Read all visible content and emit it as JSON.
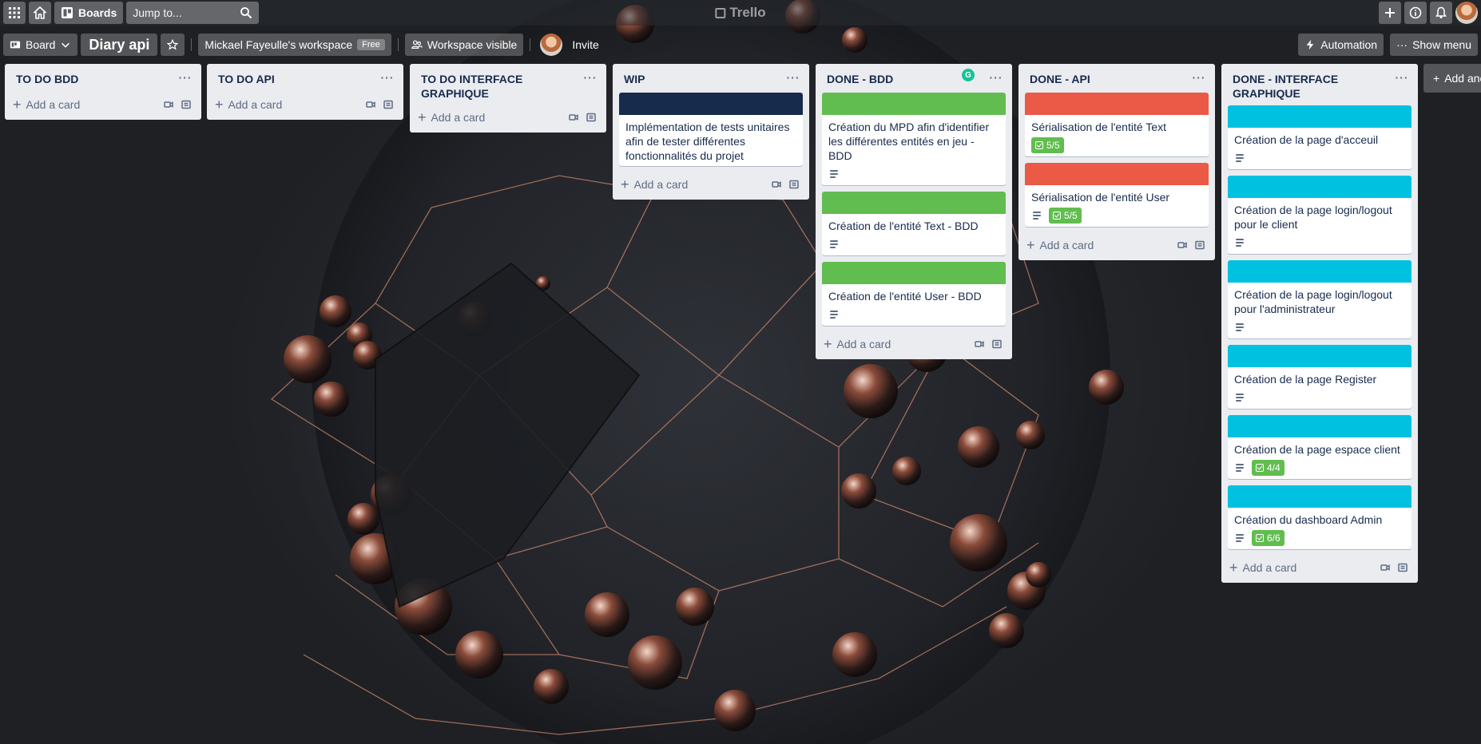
{
  "header": {
    "boards_label": "Boards",
    "search_placeholder": "Jump to...",
    "logo_text": "Trello"
  },
  "board_header": {
    "view_label": "Board",
    "title": "Diary api",
    "workspace_name": "Mickael Fayeulle's workspace",
    "workspace_badge": "Free",
    "visibility_label": "Workspace visible",
    "invite_label": "Invite",
    "automation_label": "Automation",
    "show_menu_label": "Show menu"
  },
  "lists": [
    {
      "title": "TO DO BDD",
      "add_label": "Add a card",
      "cards": []
    },
    {
      "title": "TO DO API",
      "add_label": "Add a card",
      "cards": []
    },
    {
      "title": "TO DO INTERFACE GRAPHIQUE",
      "add_label": "Add a card",
      "cards": []
    },
    {
      "title": "WIP",
      "add_label": "Add a card",
      "cards": [
        {
          "cover": "#172b4d",
          "title": "Implémentation de tests unitaires afin de tester différentes fonctionnalités du projet",
          "desc": false,
          "checklist": ""
        }
      ]
    },
    {
      "title": "DONE - BDD",
      "add_label": "Add a card",
      "cards": [
        {
          "cover": "#61bd4f",
          "title": "Création du MPD afin d'identifier les différentes entités en jeu - BDD",
          "desc": true,
          "checklist": ""
        },
        {
          "cover": "#61bd4f",
          "title": "Création de l'entité Text - BDD",
          "desc": true,
          "checklist": ""
        },
        {
          "cover": "#61bd4f",
          "title": "Création de l'entité User - BDD",
          "desc": true,
          "checklist": ""
        }
      ]
    },
    {
      "title": "DONE - API",
      "add_label": "Add a card",
      "cards": [
        {
          "cover": "#eb5a46",
          "title": "Sérialisation de l'entité Text",
          "desc": false,
          "checklist": "5/5"
        },
        {
          "cover": "#eb5a46",
          "title": "Sérialisation de l'entité User",
          "desc": true,
          "checklist": "5/5"
        }
      ]
    },
    {
      "title": "DONE - INTERFACE GRAPHIQUE",
      "add_label": "Add a card",
      "cards": [
        {
          "cover": "#00c2e0",
          "title": "Création de la page d'acceuil",
          "desc": true,
          "checklist": ""
        },
        {
          "cover": "#00c2e0",
          "title": "Création de la page login/logout pour le client",
          "desc": true,
          "checklist": ""
        },
        {
          "cover": "#00c2e0",
          "title": "Création de la page login/logout pour l'administrateur",
          "desc": true,
          "checklist": ""
        },
        {
          "cover": "#00c2e0",
          "title": "Création de la page Register",
          "desc": true,
          "checklist": ""
        },
        {
          "cover": "#00c2e0",
          "title": "Création de la page espace client",
          "desc": true,
          "checklist": "4/4"
        },
        {
          "cover": "#00c2e0",
          "title": "Création du dashboard Admin",
          "desc": true,
          "checklist": "6/6"
        }
      ]
    }
  ],
  "add_list_label": "Add another list",
  "icons": {
    "apps": "apps-grid-icon",
    "home": "home-icon",
    "boards": "boards-icon",
    "search": "search-icon",
    "create": "plus-icon",
    "info": "info-icon",
    "notifications": "bell-icon",
    "star": "star-icon",
    "visibility": "workspace-visible-icon",
    "automation": "lightning-icon",
    "menu": "more-icon"
  }
}
